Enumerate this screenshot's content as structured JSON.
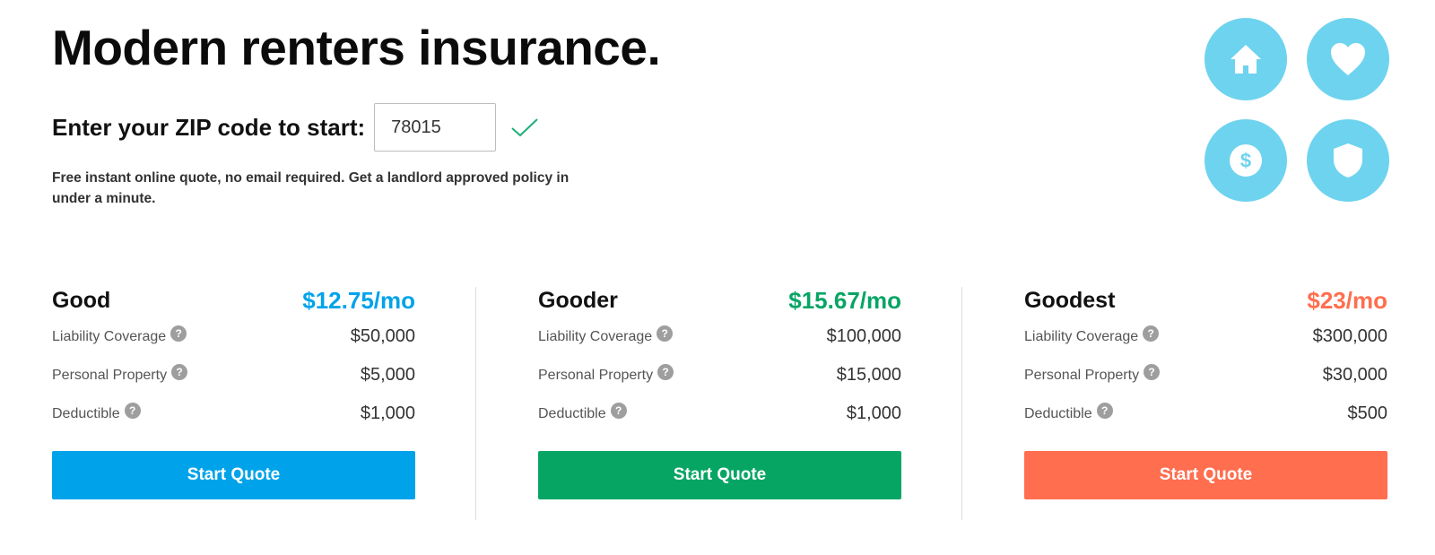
{
  "header": {
    "title": "Modern renters insurance.",
    "zip_label": "Enter your ZIP code to start:",
    "zip_value": "78015",
    "subtext": "Free instant online quote, no email required. Get a landlord approved policy in under a minute."
  },
  "icons": {
    "circle_color": "#6ed3ee",
    "items": [
      "home-icon",
      "heart-icon",
      "dollar-icon",
      "shield-icon"
    ]
  },
  "plans": [
    {
      "name": "Good",
      "price": "$12.75/mo",
      "color": "#00a3ea",
      "rows": [
        {
          "label": "Liability Coverage",
          "value": "$50,000"
        },
        {
          "label": "Personal Property",
          "value": "$5,000"
        },
        {
          "label": "Deductible",
          "value": "$1,000"
        }
      ],
      "cta": "Start Quote"
    },
    {
      "name": "Gooder",
      "price": "$15.67/mo",
      "color": "#07a564",
      "rows": [
        {
          "label": "Liability Coverage",
          "value": "$100,000"
        },
        {
          "label": "Personal Property",
          "value": "$15,000"
        },
        {
          "label": "Deductible",
          "value": "$1,000"
        }
      ],
      "cta": "Start Quote"
    },
    {
      "name": "Goodest",
      "price": "$23/mo",
      "color": "#ff6e4f",
      "rows": [
        {
          "label": "Liability Coverage",
          "value": "$300,000"
        },
        {
          "label": "Personal Property",
          "value": "$30,000"
        },
        {
          "label": "Deductible",
          "value": "$500"
        }
      ],
      "cta": "Start Quote"
    }
  ],
  "help_glyph": "?"
}
